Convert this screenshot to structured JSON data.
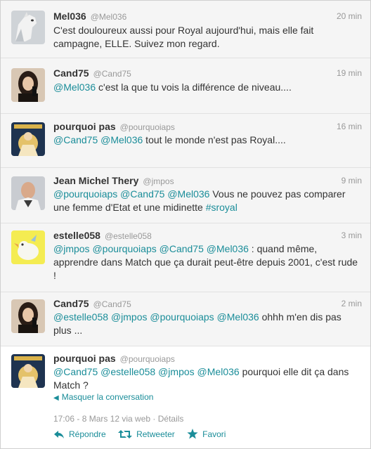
{
  "tweets": [
    {
      "name": "Mel036",
      "handle": "@Mel036",
      "time": "20 min",
      "text": [
        {
          "t": "C'est douloureux aussi pour Royal aujourd'hui, mais elle fait campagne, ELLE. Suivez mon regard.",
          "k": "text"
        }
      ]
    },
    {
      "name": "Cand75",
      "handle": "@Cand75",
      "time": "19 min",
      "text": [
        {
          "t": "@Mel036",
          "k": "mention"
        },
        {
          "t": " c'est la que tu vois la différence de niveau....",
          "k": "text"
        }
      ]
    },
    {
      "name": "pourquoi pas",
      "handle": "@pourquoiaps",
      "time": "16 min",
      "text": [
        {
          "t": "@Cand75",
          "k": "mention"
        },
        {
          "t": " ",
          "k": "text"
        },
        {
          "t": "@Mel036",
          "k": "mention"
        },
        {
          "t": " tout le monde n'est pas Royal....",
          "k": "text"
        }
      ]
    },
    {
      "name": "Jean Michel Thery",
      "handle": "@jmpos",
      "time": "9 min",
      "text": [
        {
          "t": "@pourquoiaps",
          "k": "mention"
        },
        {
          "t": " ",
          "k": "text"
        },
        {
          "t": "@Cand75",
          "k": "mention"
        },
        {
          "t": " ",
          "k": "text"
        },
        {
          "t": "@Mel036",
          "k": "mention"
        },
        {
          "t": " Vous ne pouvez pas comparer une femme d'Etat et une midinette ",
          "k": "text"
        },
        {
          "t": "#sroyal",
          "k": "hashtag"
        }
      ]
    },
    {
      "name": "estelle058",
      "handle": "@estelle058",
      "time": "3 min",
      "text": [
        {
          "t": "@jmpos",
          "k": "mention"
        },
        {
          "t": " ",
          "k": "text"
        },
        {
          "t": "@pourquoiaps",
          "k": "mention"
        },
        {
          "t": " ",
          "k": "text"
        },
        {
          "t": "@Cand75",
          "k": "mention"
        },
        {
          "t": " ",
          "k": "text"
        },
        {
          "t": "@Mel036",
          "k": "mention"
        },
        {
          "t": " : quand même, apprendre dans Match que ça durait peut-être depuis 2001, c'est rude !",
          "k": "text"
        }
      ]
    },
    {
      "name": "Cand75",
      "handle": "@Cand75",
      "time": "2 min",
      "text": [
        {
          "t": "@estelle058",
          "k": "mention"
        },
        {
          "t": " ",
          "k": "text"
        },
        {
          "t": "@jmpos",
          "k": "mention"
        },
        {
          "t": " ",
          "k": "text"
        },
        {
          "t": "@pourquoiaps",
          "k": "mention"
        },
        {
          "t": " ",
          "k": "text"
        },
        {
          "t": "@Mel036",
          "k": "mention"
        },
        {
          "t": " ohhh m'en dis pas plus ...",
          "k": "text"
        }
      ]
    },
    {
      "name": "pourquoi pas",
      "handle": "@pourquoiaps",
      "time": "",
      "text": [
        {
          "t": "@Cand75",
          "k": "mention"
        },
        {
          "t": " ",
          "k": "text"
        },
        {
          "t": "@estelle058",
          "k": "mention"
        },
        {
          "t": " ",
          "k": "text"
        },
        {
          "t": "@jmpos",
          "k": "mention"
        },
        {
          "t": " ",
          "k": "text"
        },
        {
          "t": "@Mel036",
          "k": "mention"
        },
        {
          "t": " pourquoi elle dit ça dans Match ?",
          "k": "text"
        }
      ]
    }
  ],
  "focused": {
    "conversation_toggle": "Masquer la conversation",
    "meta": "17:06 - 8 Mars 12 via web · Détails",
    "reply_label": "Répondre",
    "retweet_label": "Retweeter",
    "favorite_label": "Favori"
  },
  "colors": {
    "link": "#1a8d99",
    "name": "#333333",
    "muted": "#999999"
  }
}
